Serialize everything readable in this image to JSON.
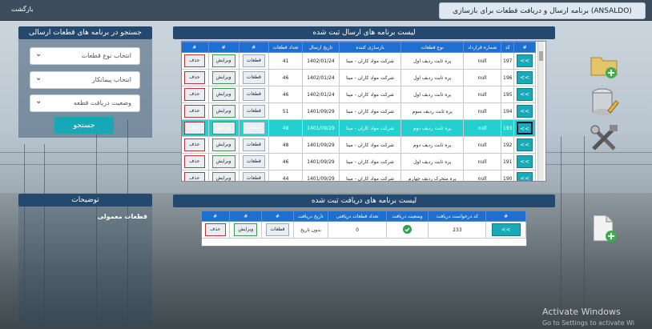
{
  "topbar": {
    "back": "بازگشت",
    "title": "برنامه ارسال و دریافت قطعات برای بازسازی (ANSALDO)"
  },
  "search": {
    "title": "جستجو در برنامه های قطعات ارسالی",
    "sel1": "انتخاب نوع قطعات",
    "sel2": "انتخاب پیمانکار",
    "sel3": "وضعیت دریافت قطعه",
    "button": "جستجو"
  },
  "desc": {
    "title": "توضیحات",
    "text": "قطعات معمولی"
  },
  "sent": {
    "title": "لیست برنامه های ارسال ثبت شده",
    "headers": [
      "#",
      "کد",
      "شماره قرارداد",
      "نوع قطعات",
      "بازسازی کننده",
      "تاریخ ارسال",
      "تعداد قطعات",
      "#",
      "#",
      "#"
    ],
    "rows": [
      {
        "go": ">>",
        "code": "197",
        "contract": "null",
        "type": "پره ثابت ردیف اول",
        "vendor": "شرکت مواد کاران - مینا",
        "date": "1402/01/24",
        "count": "41"
      },
      {
        "go": ">>",
        "code": "196",
        "contract": "null",
        "type": "پره ثابت ردیف اول",
        "vendor": "شرکت مواد کاران - مینا",
        "date": "1402/01/24",
        "count": "46"
      },
      {
        "go": ">>",
        "code": "195",
        "contract": "null",
        "type": "پره ثابت ردیف اول",
        "vendor": "شرکت مواد کاران - مینا",
        "date": "1402/01/24",
        "count": "46"
      },
      {
        "go": ">>",
        "code": "194",
        "contract": "null",
        "type": "پره ثابت ردیف سوم",
        "vendor": "شرکت مواد کاران - مینا",
        "date": "1401/09/29",
        "count": "51"
      },
      {
        "go": ">>",
        "code": "193",
        "contract": "null",
        "type": "پره ثابت ردیف دوم",
        "vendor": "شرکت مواد کاران - مینا",
        "date": "1401/09/29",
        "count": "48"
      },
      {
        "go": ">>",
        "code": "192",
        "contract": "null",
        "type": "پره ثابت ردیف دوم",
        "vendor": "شرکت مواد کاران - مینا",
        "date": "1401/09/29",
        "count": "48"
      },
      {
        "go": ">>",
        "code": "191",
        "contract": "null",
        "type": "پره ثابت ردیف اول",
        "vendor": "شرکت مواد کاران - مینا",
        "date": "1401/09/29",
        "count": "46"
      },
      {
        "go": ">>",
        "code": "190",
        "contract": "null",
        "type": "پره متحرک ردیف چهارم",
        "vendor": "شرکت مواد کاران - مینا",
        "date": "1401/09/29",
        "count": "44"
      }
    ],
    "btn_parts": "قطعات",
    "btn_edit": "ویرایش",
    "btn_del": "حذف"
  },
  "recv": {
    "title": "لیست برنامه های دریافت ثبت شده",
    "headers": [
      "#",
      "کد درخواست دریافت",
      "وضعیت دریافت",
      "تعداد قطعات دریافتی",
      "تاریخ دریافت",
      "#",
      "#",
      "#"
    ],
    "row": {
      "go": ">>",
      "code": "233",
      "count": "0",
      "date": "بدون تاریخ"
    },
    "btn_parts": "قطعات",
    "btn_edit": "ویرایش",
    "btn_del": "حذف"
  },
  "watermark": {
    "line1": "Activate Windows",
    "line2": "Go to Settings to activate Wi"
  },
  "colors": {
    "header": "#24496f",
    "accent": "#17a8b5",
    "th": "#1f6fd0",
    "highlight": "#24cfcf"
  }
}
